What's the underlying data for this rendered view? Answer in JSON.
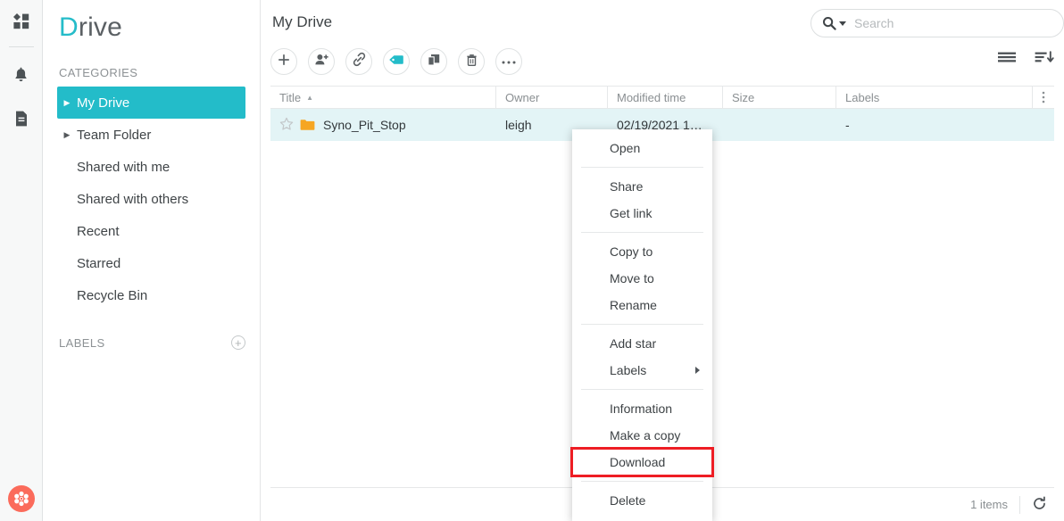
{
  "rail": {
    "items": [
      {
        "name": "apps-grid-icon",
        "label": "Apps"
      },
      {
        "name": "bell-icon",
        "label": "Notifications"
      },
      {
        "name": "document-icon",
        "label": "Documents"
      }
    ],
    "bottom_badge": "synology-drive-icon"
  },
  "sidebar": {
    "brand_first": "D",
    "brand_rest": "rive",
    "categories_label": "CATEGORIES",
    "items": [
      {
        "label": "My Drive",
        "expandable": true,
        "active": true
      },
      {
        "label": "Team Folder",
        "expandable": true,
        "active": false
      },
      {
        "label": "Shared with me",
        "expandable": false,
        "active": false
      },
      {
        "label": "Shared with others",
        "expandable": false,
        "active": false
      },
      {
        "label": "Recent",
        "expandable": false,
        "active": false
      },
      {
        "label": "Starred",
        "expandable": false,
        "active": false
      },
      {
        "label": "Recycle Bin",
        "expandable": false,
        "active": false
      }
    ],
    "labels_label": "LABELS",
    "add_label_icon": "plus-circle-icon"
  },
  "header": {
    "title": "My Drive",
    "search": {
      "placeholder": "Search",
      "value": "",
      "icon": "search-icon",
      "caret": "chevron-down-icon"
    }
  },
  "toolbar": {
    "buttons": [
      {
        "name": "new-button",
        "icon": "plus-icon"
      },
      {
        "name": "share-button",
        "icon": "add-person-icon"
      },
      {
        "name": "get-link-button",
        "icon": "link-icon"
      },
      {
        "name": "labels-button",
        "icon": "tag-icon"
      },
      {
        "name": "copy-button",
        "icon": "copy-icon"
      },
      {
        "name": "delete-button",
        "icon": "trash-icon"
      },
      {
        "name": "more-button",
        "icon": "ellipsis-icon"
      }
    ],
    "right_buttons": [
      {
        "name": "view-mode-button",
        "icon": "list-view-icon"
      },
      {
        "name": "sort-button",
        "icon": "sort-descending-icon"
      }
    ]
  },
  "table": {
    "columns": [
      {
        "key": "title",
        "label": "Title",
        "sorted": "asc"
      },
      {
        "key": "owner",
        "label": "Owner",
        "sorted": ""
      },
      {
        "key": "mtime",
        "label": "Modified time",
        "sorted": ""
      },
      {
        "key": "size",
        "label": "Size",
        "sorted": ""
      },
      {
        "key": "labels",
        "label": "Labels",
        "sorted": ""
      }
    ],
    "column_menu_icon": "kebab-menu-icon",
    "sort_asc_glyph": "▲",
    "rows": [
      {
        "star": "star-outline-icon",
        "icon": "folder-icon",
        "title": "Syno_Pit_Stop",
        "owner": "leigh",
        "mtime": "02/19/2021 1…",
        "size": "",
        "labels": "-",
        "selected": true
      }
    ]
  },
  "statusbar": {
    "count": "1 items",
    "refresh_icon": "refresh-icon"
  },
  "context_menu": {
    "groups": [
      [
        {
          "label": "Open"
        }
      ],
      [
        {
          "label": "Share"
        },
        {
          "label": "Get link"
        }
      ],
      [
        {
          "label": "Copy to"
        },
        {
          "label": "Move to"
        },
        {
          "label": "Rename"
        }
      ],
      [
        {
          "label": "Add star"
        },
        {
          "label": "Labels",
          "submenu": true
        }
      ],
      [
        {
          "label": "Information"
        },
        {
          "label": "Make a copy"
        },
        {
          "label": "Download",
          "highlighted": true
        }
      ],
      [
        {
          "label": "Delete"
        }
      ]
    ]
  },
  "colors": {
    "accent_teal": "#23bcc9",
    "row_selected": "#e3f4f6",
    "folder_orange": "#f5a623",
    "highlight_red": "#ee1d24",
    "badge_coral": "#fb6b5b"
  }
}
